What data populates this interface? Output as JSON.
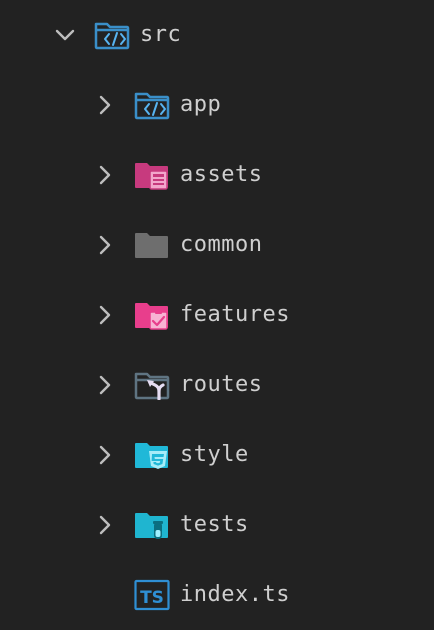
{
  "explorer": {
    "root": {
      "label": "src",
      "expanded": true,
      "icon": "folder-code-icon",
      "color": "#3a8fc9"
    },
    "children": [
      {
        "label": "app",
        "type": "folder",
        "icon": "folder-code-icon",
        "color": "#3a8fc9"
      },
      {
        "label": "assets",
        "type": "folder",
        "icon": "folder-assets-icon",
        "color": "#c73a7e"
      },
      {
        "label": "common",
        "type": "folder",
        "icon": "folder-icon",
        "color": "#6e6e6e"
      },
      {
        "label": "features",
        "type": "folder",
        "icon": "folder-features-icon",
        "color": "#e83e8c"
      },
      {
        "label": "routes",
        "type": "folder",
        "icon": "folder-routes-icon",
        "color": "#5f7482"
      },
      {
        "label": "style",
        "type": "folder",
        "icon": "folder-css-icon",
        "color": "#20b8d8"
      },
      {
        "label": "tests",
        "type": "folder",
        "icon": "folder-test-icon",
        "color": "#1fb5d0"
      },
      {
        "label": "index.ts",
        "type": "file",
        "icon": "typescript-file-icon",
        "color": "#2f8fd4"
      }
    ]
  }
}
